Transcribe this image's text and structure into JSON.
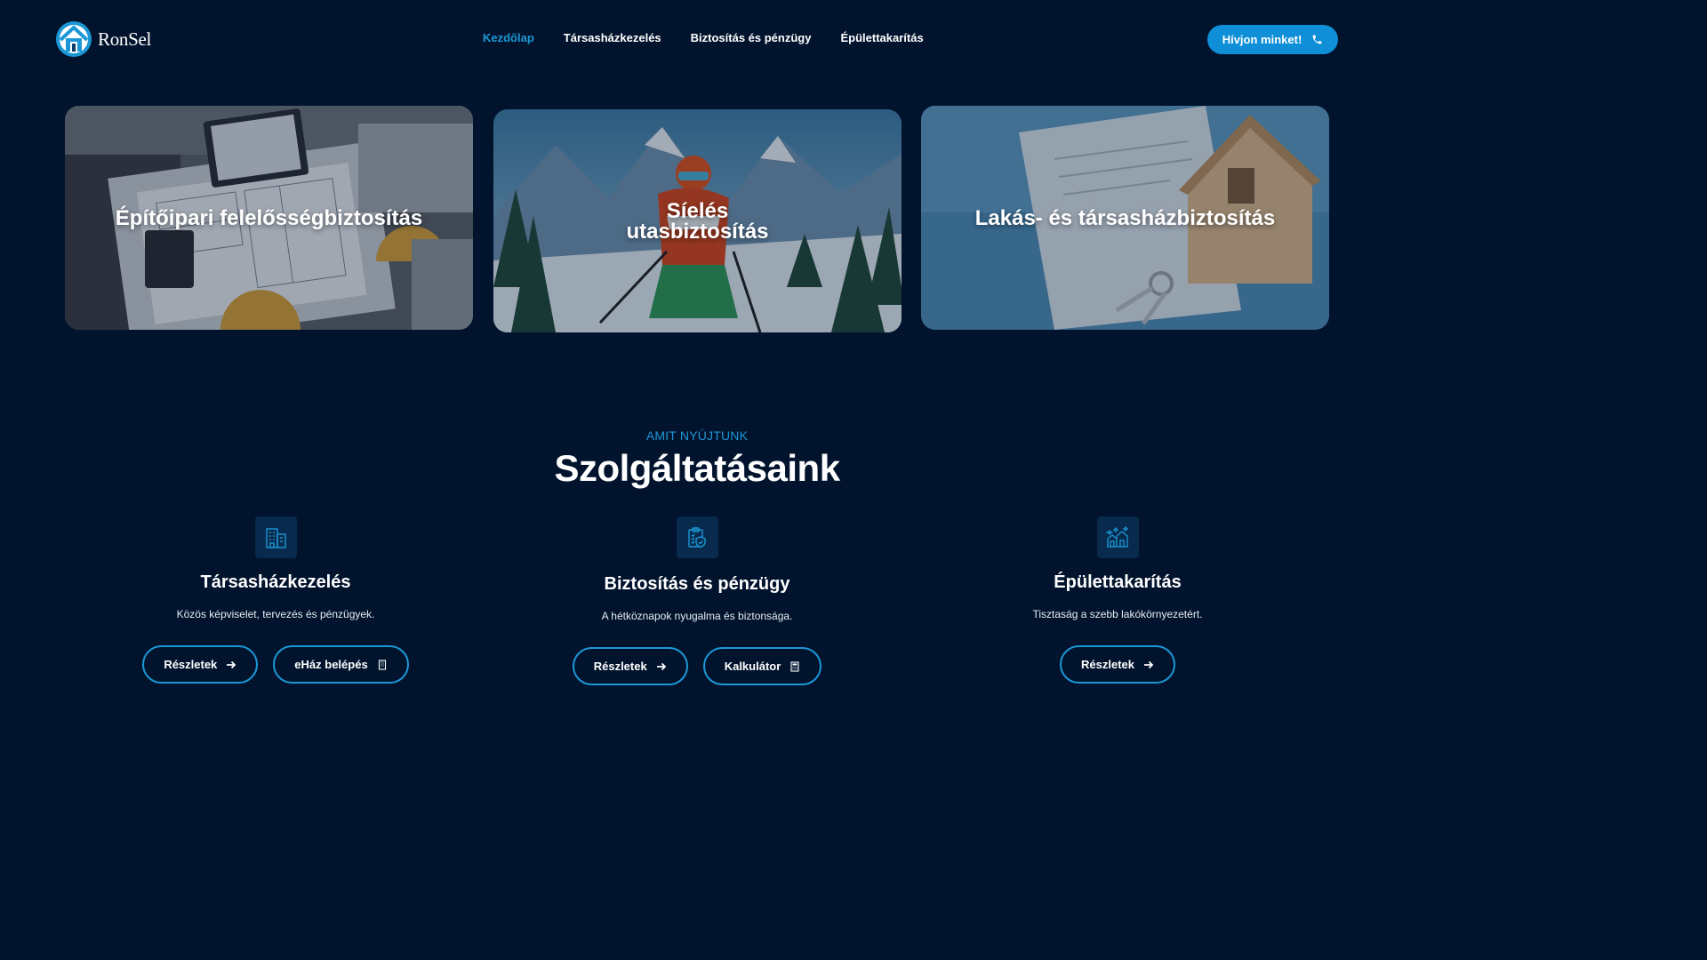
{
  "brand": {
    "name": "RonSel",
    "logo_icon": "house-logo-icon"
  },
  "nav": {
    "items": [
      {
        "label": "Kezdőlap",
        "active": true
      },
      {
        "label": "Társasházkezelés",
        "active": false
      },
      {
        "label": "Biztosítás és pénzügy",
        "active": false
      },
      {
        "label": "Épülettakarítás",
        "active": false
      }
    ],
    "cta": {
      "label": "Hívjon minket!",
      "icon": "phone-icon"
    }
  },
  "hero_cards": [
    {
      "title": "Építőipari felelősségbiztosítás",
      "image": "architect-desk-blueprints"
    },
    {
      "title": "Síelés utasbiztosítás",
      "image": "skier-in-mountains"
    },
    {
      "title": "Lakás- és társasházbiztosítás",
      "image": "wooden-house-model-keys"
    }
  ],
  "services": {
    "eyebrow": "AMIT NYÚJTUNK",
    "title": "Szolgáltatásaink",
    "items": [
      {
        "icon": "apartment-building-icon",
        "title": "Társasházkezelés",
        "description": "Közös képviselet, tervezés és pénzügyek.",
        "buttons": [
          {
            "label": "Részletek",
            "icon": "arrow-right-icon"
          },
          {
            "label": "eHáz belépés",
            "icon": "building-icon"
          }
        ]
      },
      {
        "icon": "insurance-document-icon",
        "title": "Biztosítás és pénzügy",
        "description": "A hétköznapok nyugalma és biztonsága.",
        "buttons": [
          {
            "label": "Részletek",
            "icon": "arrow-right-icon"
          },
          {
            "label": "Kalkulátor",
            "icon": "calculator-icon"
          }
        ]
      },
      {
        "icon": "clean-houses-icon",
        "title": "Épülettakarítás",
        "description": "Tisztaság a szebb lakókörnyezetért.",
        "buttons": [
          {
            "label": "Részletek",
            "icon": "arrow-right-icon"
          }
        ]
      }
    ]
  },
  "colors": {
    "background": "#02142d",
    "accent": "#1c97d6",
    "cta": "#0f8fd8"
  }
}
